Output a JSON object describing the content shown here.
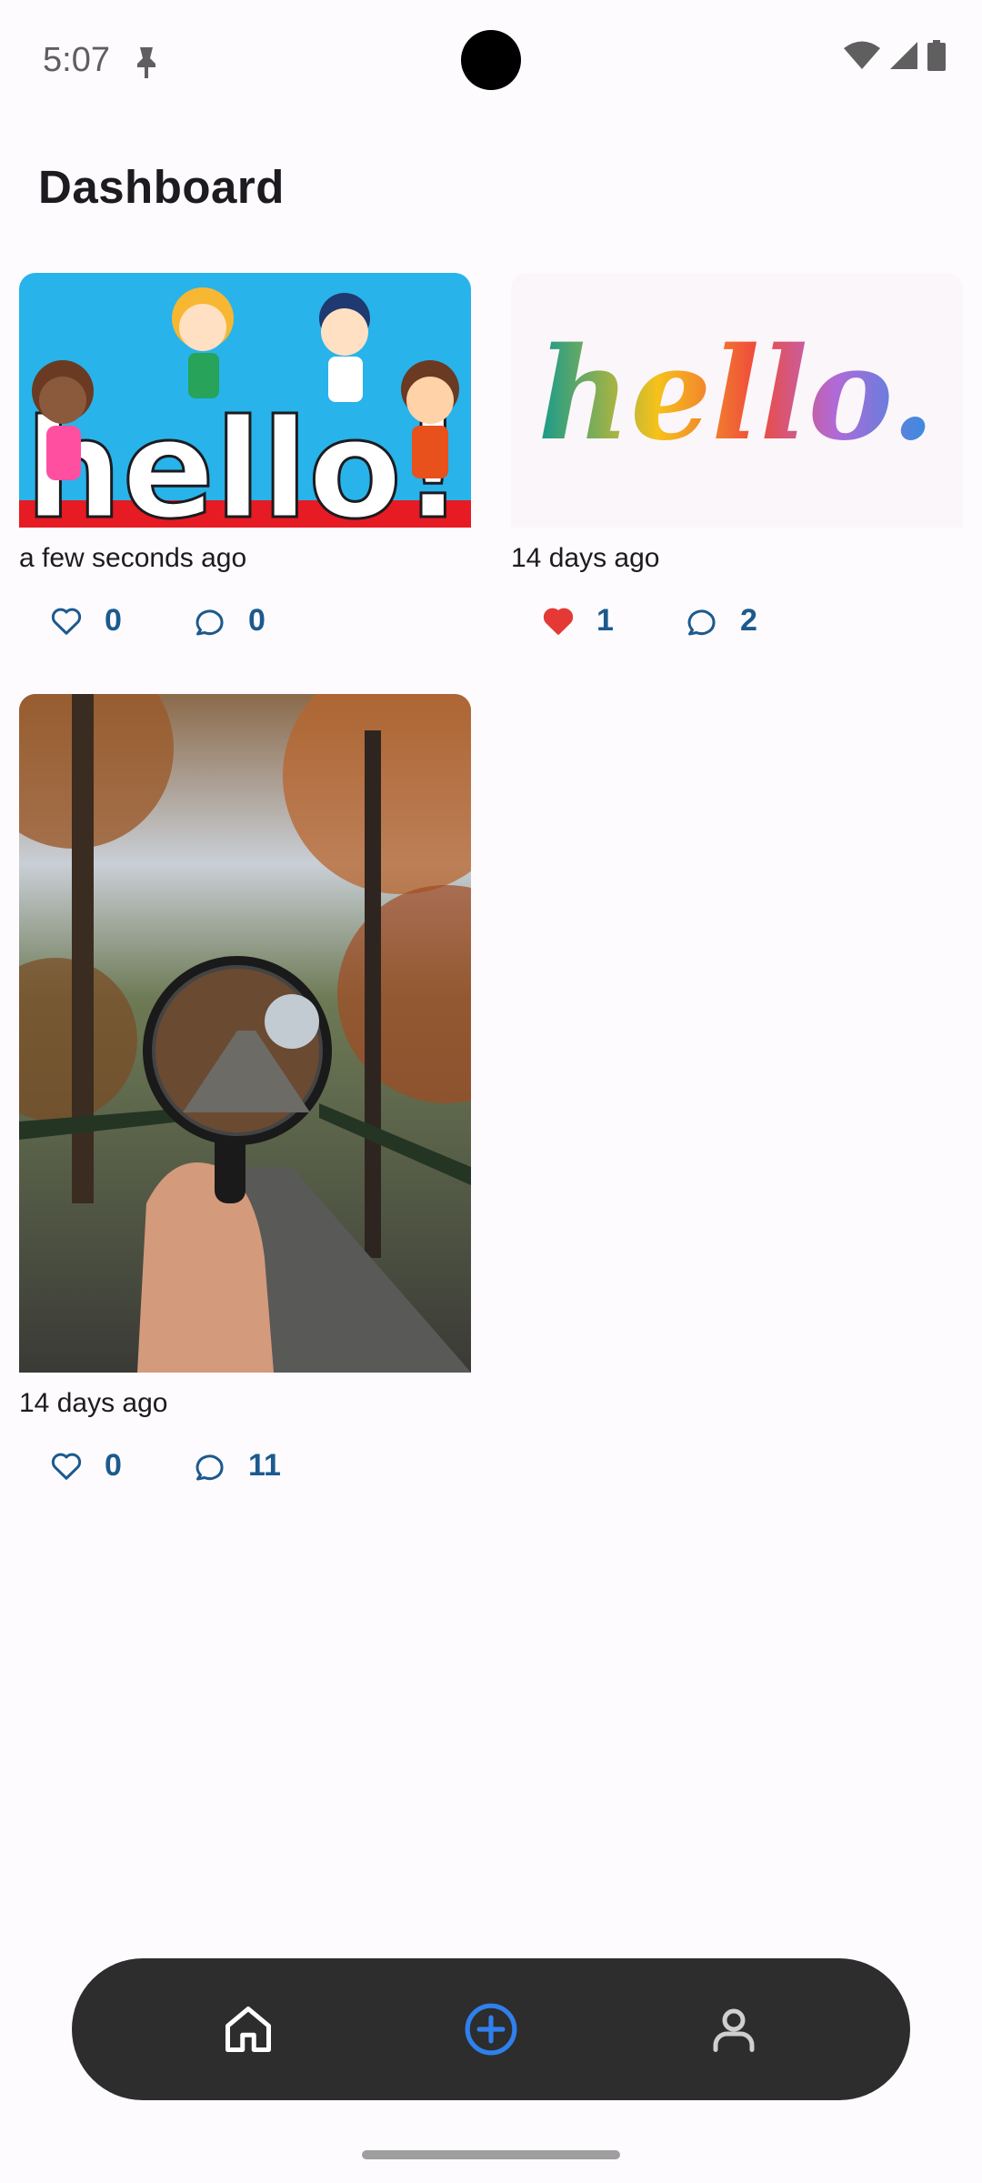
{
  "status_bar": {
    "time": "5:07",
    "icons": [
      "lock-icon",
      "wifi-icon",
      "signal-icon",
      "battery-icon"
    ]
  },
  "header": {
    "title": "Dashboard"
  },
  "posts": [
    {
      "image": "hello-kids-cartoon",
      "timestamp": "a few seconds ago",
      "likes": "0",
      "comments": "0",
      "liked": false
    },
    {
      "image": "hello-rainbow-script",
      "timestamp": "14 days ago",
      "likes": "1",
      "comments": "2",
      "liked": true
    },
    {
      "image": "magnifying-glass-autumn-path",
      "timestamp": "14 days ago",
      "likes": "0",
      "comments": "11",
      "liked": false
    }
  ],
  "bottom_nav": {
    "items": [
      "home-icon",
      "add-post-icon",
      "profile-icon"
    ],
    "active": "add-post-icon"
  },
  "colors": {
    "background": "#fdfbfe",
    "accent": "#1c5a8e",
    "liked_heart": "#e53935",
    "nav_background": "#2d2d2d",
    "nav_active": "#2f80ed"
  }
}
